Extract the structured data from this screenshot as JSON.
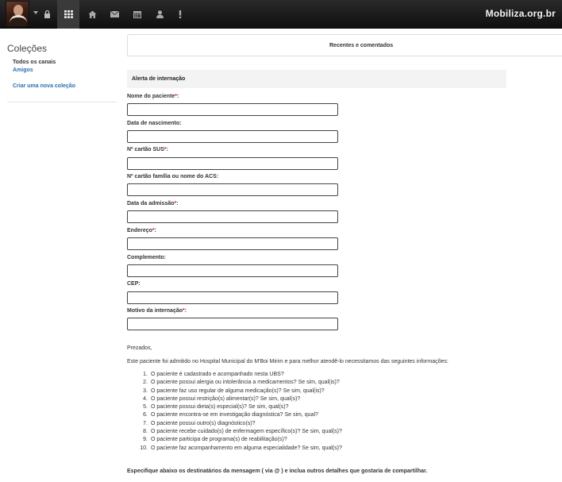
{
  "topbar": {
    "brand": "Mobiliza.org.br",
    "icons": [
      "lock-icon",
      "grid-icon",
      "home-icon",
      "mail-icon",
      "calendar-icon",
      "user-icon",
      "alert-icon"
    ]
  },
  "sidebar": {
    "title": "Coleções",
    "all_channels": "Todos os canais",
    "friends": "Amigos",
    "create_collection": "Criar uma nova coleção"
  },
  "main": {
    "tab_label": "Recentes e comentados",
    "form_title": "Alerta de internação",
    "fields": [
      {
        "label": "Nome do paciente",
        "required": "*",
        "colon": ":",
        "value": ""
      },
      {
        "label": "Data de nascimento",
        "required": "",
        "colon": ":",
        "value": ""
      },
      {
        "label": "Nº cartão SUS",
        "required": "*",
        "colon": ":",
        "value": ""
      },
      {
        "label": "Nº cartão família ou nome do ACS",
        "required": "",
        "colon": ":",
        "value": ""
      },
      {
        "label": "Data da admissão",
        "required": "*",
        "colon": ":",
        "value": ""
      },
      {
        "label": "Endereço",
        "required": "*",
        "colon": ":",
        "value": ""
      },
      {
        "label": "Complemento",
        "required": "",
        "colon": ":",
        "value": ""
      },
      {
        "label": "CEP",
        "required": "",
        "colon": ":",
        "value": ""
      },
      {
        "label": "Motivo da internação",
        "required": "*",
        "colon": ":",
        "value": ""
      }
    ],
    "greeting": "Prezados,",
    "intro": "Este paciente foi admitido no Hospital Municipal do M'Boi Mirim e para melhor atendê-lo necessitamos das seguintes informações:",
    "questions": [
      "O paciente é cadastrado e acompanhado nesta UBS?",
      "O paciente possui alergia ou intolerância a medicamentos? Se sim, qual(is)?",
      "O paciente faz uso regular de alguma medicação(s)? Se sim, qual(is)?",
      "O paciente possui restrição(s) alimentar(s)? Se sim, qual(s)?",
      "O paciente possui dieta(s) especial(s)? Se sim, qual(s)?",
      "O paciente encontra-se em investigação diagnóstica? Se sim, qual?",
      "O paciente possui outro(s) diagnóstico(s)?",
      "O paciente recebe cuidado(s) de enfermagem específico(s)? Se sim, qual(s)?",
      "O paciente participa de programa(s) de reabilitação(s)?",
      "O paciente faz acompanhamento em alguma especialidade? Se sim, qual(s)?"
    ],
    "footer": "Especifique abaixo os destinatários da mensagem ( via @ ) e inclua outros detalhes que gostaria de compartilhar."
  }
}
